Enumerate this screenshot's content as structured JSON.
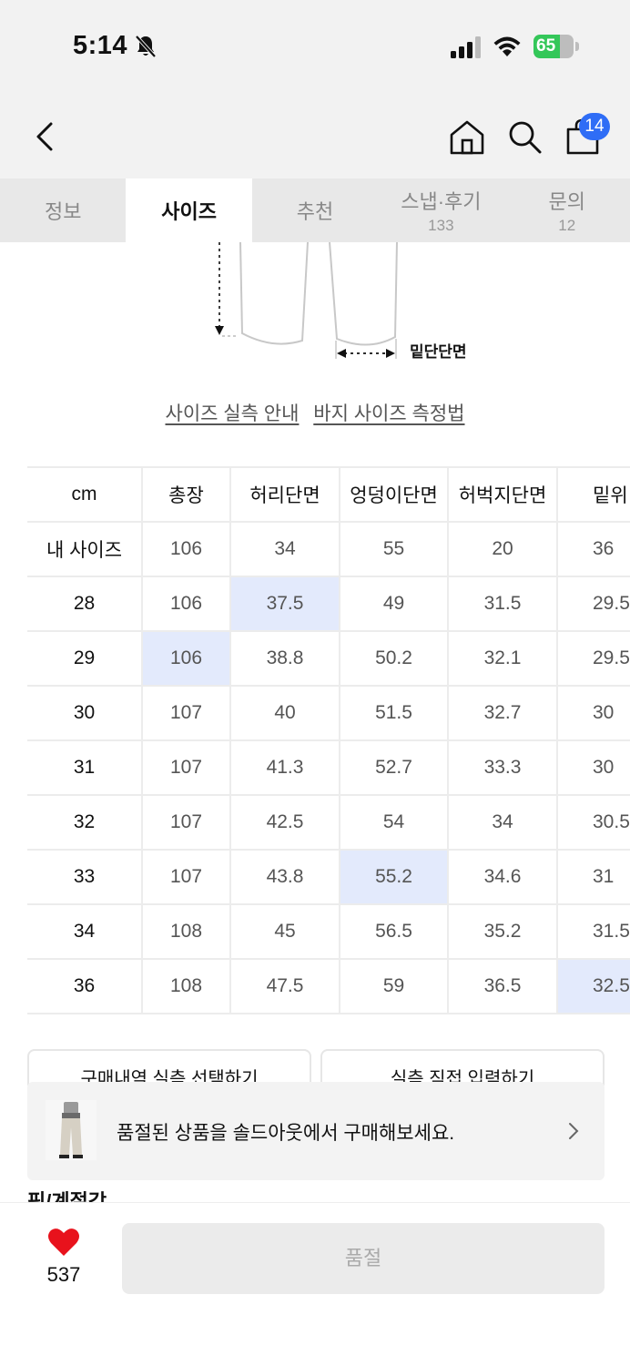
{
  "status": {
    "time": "5:14",
    "battery": "65",
    "battery_level": 0.65
  },
  "header": {
    "cart_badge": "14"
  },
  "tabs": [
    {
      "label": "정보",
      "count": ""
    },
    {
      "label": "사이즈",
      "count": ""
    },
    {
      "label": "추천",
      "count": ""
    },
    {
      "label": "스냅·후기",
      "count": "133"
    },
    {
      "label": "문의",
      "count": "12"
    }
  ],
  "diagram": {
    "hem_label": "밑단단면"
  },
  "guide": {
    "link1": "사이즈 실측 안내",
    "link2": "바지 사이즈 측정법"
  },
  "table": {
    "unit": "cm",
    "headers": [
      "총장",
      "허리단면",
      "엉덩이단면",
      "허벅지단면",
      "밑위"
    ],
    "my_size": {
      "label": "내 사이즈",
      "values": [
        "106",
        "34",
        "55",
        "20",
        "36"
      ]
    },
    "rows": [
      {
        "size": "28",
        "values": [
          "106",
          "37.5",
          "49",
          "31.5",
          "29.5"
        ]
      },
      {
        "size": "29",
        "values": [
          "106",
          "38.8",
          "50.2",
          "32.1",
          "29.5"
        ]
      },
      {
        "size": "30",
        "values": [
          "107",
          "40",
          "51.5",
          "32.7",
          "30"
        ]
      },
      {
        "size": "31",
        "values": [
          "107",
          "41.3",
          "52.7",
          "33.3",
          "30"
        ]
      },
      {
        "size": "32",
        "values": [
          "107",
          "42.5",
          "54",
          "34",
          "30.5"
        ]
      },
      {
        "size": "33",
        "values": [
          "107",
          "43.8",
          "55.2",
          "34.6",
          "31"
        ]
      },
      {
        "size": "34",
        "values": [
          "108",
          "45",
          "56.5",
          "35.2",
          "31.5"
        ]
      },
      {
        "size": "36",
        "values": [
          "108",
          "47.5",
          "59",
          "36.5",
          "32.5"
        ]
      }
    ]
  },
  "actions": {
    "select_purchase": "구매내역 실측 선택하기",
    "direct_input": "실측 직접 입력하기"
  },
  "soldout_banner": {
    "text": "품절된 상품을 솔드아웃에서 구매해보세요."
  },
  "section_peek": "핏/계절감",
  "bottom": {
    "like_count": "537",
    "button": "품절"
  }
}
